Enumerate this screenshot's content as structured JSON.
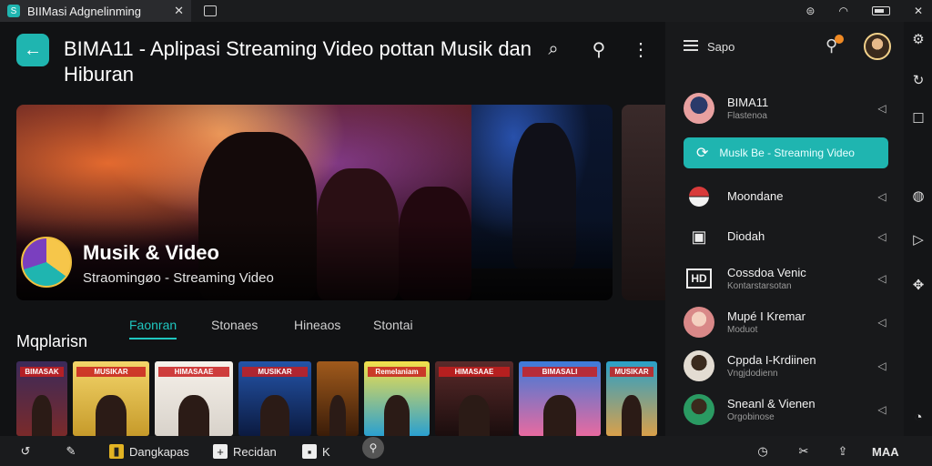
{
  "browser": {
    "tab_title": "BIIMasi Adgnelinming",
    "close_label": "✕"
  },
  "header": {
    "title": "BIMA11 - Aplipasi Streaming Video pottan Musik dan Hiburan"
  },
  "hero": {
    "title": "Musik & Video",
    "subtitle": "Straomingøo  - Streaming Video"
  },
  "section": {
    "label": "Mqplarisn",
    "tabs": [
      {
        "label": "Faonran",
        "active": true
      },
      {
        "label": "Stonaes",
        "active": false
      },
      {
        "label": "Hineaos",
        "active": false
      },
      {
        "label": "Stontai",
        "active": false
      }
    ]
  },
  "covers": [
    {
      "title": "BIMASAK",
      "color1": "#3b2a5a",
      "color2": "#7a2a2a"
    },
    {
      "title": "MUSIKAR",
      "color1": "#f3d56a",
      "color2": "#c69a2a"
    },
    {
      "title": "HIMASAAE",
      "color1": "#f6f1ea",
      "color2": "#d8d2ca"
    },
    {
      "title": "MUSIKAR",
      "color1": "#2454a8",
      "color2": "#0b1a40"
    },
    {
      "title": "",
      "color1": "#a05a1c",
      "color2": "#3a1c08"
    },
    {
      "title": "Remelaniam",
      "color1": "#f4e04a",
      "color2": "#2aa0d0"
    },
    {
      "title": "HIMASAAE",
      "color1": "#5a2a2a",
      "color2": "#1a0d0d"
    },
    {
      "title": "BIMASALI",
      "color1": "#3d7bd9",
      "color2": "#e86aa0"
    },
    {
      "title": "MUSIKAR",
      "color1": "#2aa0c8",
      "color2": "#d9a04a"
    }
  ],
  "panel": {
    "search_label": "Sapo",
    "items": [
      {
        "name": "BIMA11",
        "sub": "Flastenoa",
        "avatar": "#e8a0a0"
      },
      {
        "name": "Muslk Be - Streaming Video",
        "sub": "",
        "selected": true
      },
      {
        "name": "Moondane",
        "sub": "",
        "icon": "pokeball-icon"
      },
      {
        "name": "Diodah",
        "sub": "",
        "icon": "robot-icon"
      },
      {
        "name": "Cossdoa Venic",
        "sub": "Kontarstarsotan",
        "icon": "hd-icon"
      },
      {
        "name": "Mupé I Kremar",
        "sub": "Moduot",
        "avatar": "#d98888"
      },
      {
        "name": "Cppda I-Krdiinen",
        "sub": "Vngjdodienn",
        "avatar": "#e3dcd2"
      },
      {
        "name": "Sneanl & Vienen",
        "sub": "Orgobinose",
        "avatar": "#2a9a62"
      }
    ]
  },
  "taskbar": {
    "items": [
      {
        "label": "Dangkapas"
      },
      {
        "label": "Recidan"
      },
      {
        "label": "K"
      }
    ],
    "brand": "MAA"
  },
  "colors": {
    "accent": "#1fb5b0",
    "background": "#111214",
    "panel": "#18191b"
  }
}
